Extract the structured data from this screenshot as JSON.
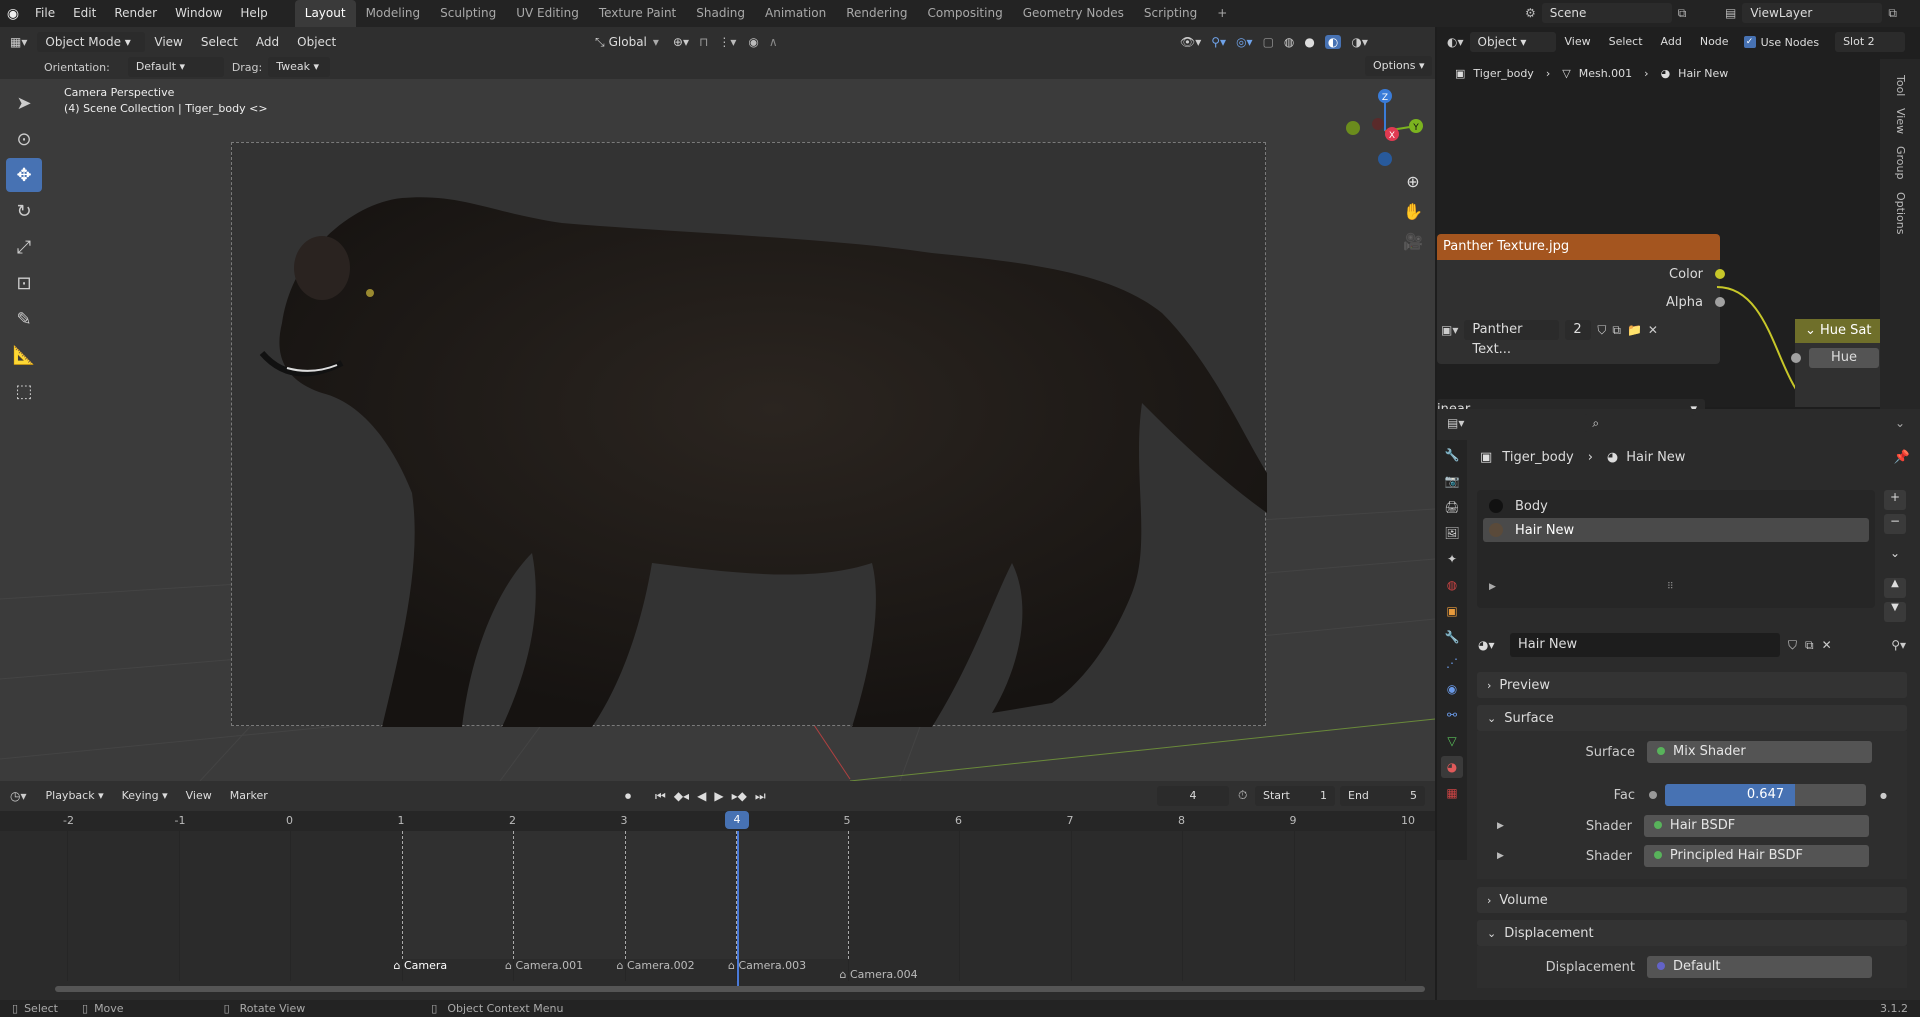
{
  "topbar": {
    "menus": [
      "File",
      "Edit",
      "Render",
      "Window",
      "Help"
    ],
    "workspaces": [
      "Layout",
      "Modeling",
      "Sculpting",
      "UV Editing",
      "Texture Paint",
      "Shading",
      "Animation",
      "Rendering",
      "Compositing",
      "Geometry Nodes",
      "Scripting"
    ],
    "add_tab": "+",
    "scene": "Scene",
    "view_layer": "ViewLayer"
  },
  "viewport_header": {
    "mode": "Object Mode",
    "menus": [
      "View",
      "Select",
      "Add",
      "Object"
    ],
    "transform_orientation": "Global",
    "orientation_label": "Orientation:",
    "orientation_value": "Default",
    "drag_label": "Drag:",
    "drag_value": "Tweak",
    "options": "Options"
  },
  "viewport": {
    "title": "Camera Perspective",
    "subtitle": "(4) Scene Collection | Tiger_body <>",
    "gizmo": {
      "z": "Z",
      "y": "Y",
      "x": "X"
    }
  },
  "timeline": {
    "menus": [
      "Playback",
      "Keying",
      "View",
      "Marker"
    ],
    "current_frame": "4",
    "start_label": "Start",
    "start": "1",
    "end_label": "End",
    "end": "5",
    "ticks": [
      "-2",
      "-1",
      "0",
      "1",
      "2",
      "3",
      "4",
      "5",
      "6",
      "7",
      "8",
      "9",
      "10"
    ],
    "markers": [
      "Camera",
      "Camera.001",
      "Camera.002",
      "Camera.003",
      "Camera.004"
    ]
  },
  "statusbar": {
    "select": "Select",
    "move": "Move",
    "rotate": "Rotate View",
    "context": "Object Context Menu",
    "version": "3.1.2"
  },
  "node_editor": {
    "object_mode": "Object",
    "menus": [
      "View",
      "Select",
      "Add",
      "Node"
    ],
    "use_nodes": "Use Nodes",
    "slot": "Slot 2",
    "breadcrumb": [
      "Tiger_body",
      "Mesh.001",
      "Hair New"
    ],
    "side_tabs": [
      "Tool",
      "View",
      "Group",
      "Options"
    ],
    "texture_node": {
      "title": "Panther Texture.jpg",
      "outputs": [
        "Color",
        "Alpha"
      ],
      "image_name": "Panther Text...",
      "users": "2",
      "interpolation": "inear"
    },
    "hue_node": {
      "title": "Hue Sat",
      "input": "Hue"
    }
  },
  "properties": {
    "search_placeholder": "",
    "breadcrumb": [
      "Tiger_body",
      "Hair New"
    ],
    "material_slots": [
      "Body",
      "Hair New"
    ],
    "material_name": "Hair New",
    "panels": {
      "preview": "Preview",
      "surface": "Surface",
      "volume": "Volume",
      "displacement": "Displacement"
    },
    "surface_rows": [
      {
        "label": "Surface",
        "value": "Mix Shader"
      },
      {
        "label": "Fac",
        "value": "0.647"
      },
      {
        "label": "Shader",
        "value": "Hair BSDF"
      },
      {
        "label": "Shader",
        "value": "Principled Hair BSDF"
      }
    ],
    "fac_fraction": 0.647,
    "displacement_row": {
      "label": "Displacement",
      "value": "Default"
    }
  }
}
